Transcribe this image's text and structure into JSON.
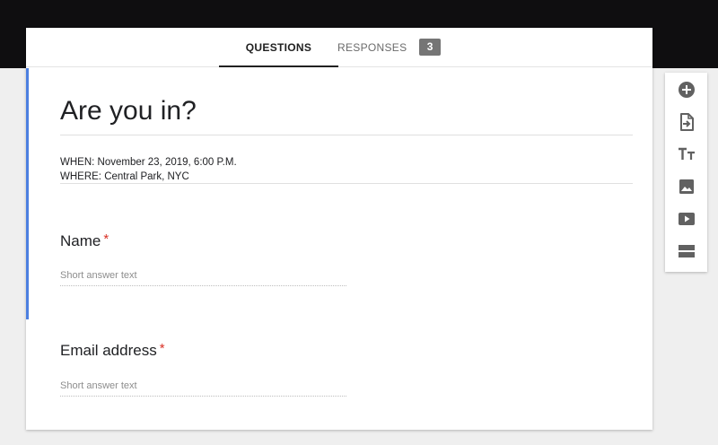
{
  "tabs": {
    "questions_label": "QUESTIONS",
    "responses_label": "RESPONSES",
    "responses_count": "3"
  },
  "form": {
    "title": "Are you in?",
    "description_line1": "WHEN: November 23, 2019, 6:00 P.M.",
    "description_line2": "WHERE: Central Park, NYC"
  },
  "questions": [
    {
      "label": "Name",
      "required_mark": "*",
      "placeholder": "Short answer text"
    },
    {
      "label": "Email address",
      "required_mark": "*",
      "placeholder": "Short answer text"
    }
  ],
  "toolbar": {
    "items": [
      {
        "icon": "add-question-icon"
      },
      {
        "icon": "import-questions-icon"
      },
      {
        "icon": "add-title-icon"
      },
      {
        "icon": "add-image-icon"
      },
      {
        "icon": "add-video-icon"
      },
      {
        "icon": "add-section-icon"
      }
    ]
  },
  "colors": {
    "accent": "#4c7fe0",
    "required": "#d93025",
    "topbar": "#0f0e10",
    "badge": "#757575"
  }
}
